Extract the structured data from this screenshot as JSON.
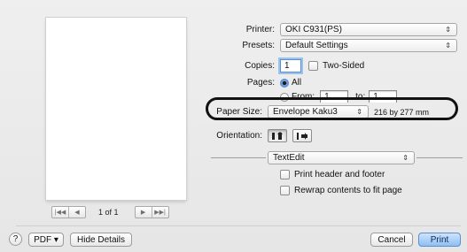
{
  "preview": {
    "page_indicator": "1 of 1",
    "first_page_icon": "first-page-icon",
    "prev_page_icon": "previous-page-icon",
    "next_page_icon": "next-page-icon",
    "last_page_icon": "last-page-icon"
  },
  "printer": {
    "label": "Printer:",
    "value": "OKI C931(PS)",
    "arrows": "⇕"
  },
  "presets": {
    "label": "Presets:",
    "value": "Default Settings",
    "arrows": "⇕"
  },
  "copies": {
    "label": "Copies:",
    "value": "1",
    "two_sided_label": "Two-Sided"
  },
  "pages": {
    "label": "Pages:",
    "all_label": "All",
    "from_label": "From:",
    "from_value": "1",
    "to_label": "to:",
    "to_value": "1"
  },
  "paper_size": {
    "label": "Paper Size:",
    "value": "Envelope Kaku3",
    "dimensions": "216 by 277 mm",
    "arrows": "⇕"
  },
  "orientation": {
    "label": "Orientation:",
    "portrait_icon": "portrait-orientation-icon",
    "landscape_icon": "landscape-orientation-icon"
  },
  "section": {
    "value": "TextEdit",
    "arrows": "⇕"
  },
  "options": {
    "print_header_footer": "Print header and footer",
    "rewrap_contents": "Rewrap contents to fit page"
  },
  "footer": {
    "help": "?",
    "pdf_label": "PDF ▾",
    "hide_details": "Hide Details",
    "cancel": "Cancel",
    "print": "Print"
  },
  "colors": {
    "accent": "#3d7bd6",
    "default_button": "#8fbff2",
    "highlight_outline": "#111111"
  }
}
